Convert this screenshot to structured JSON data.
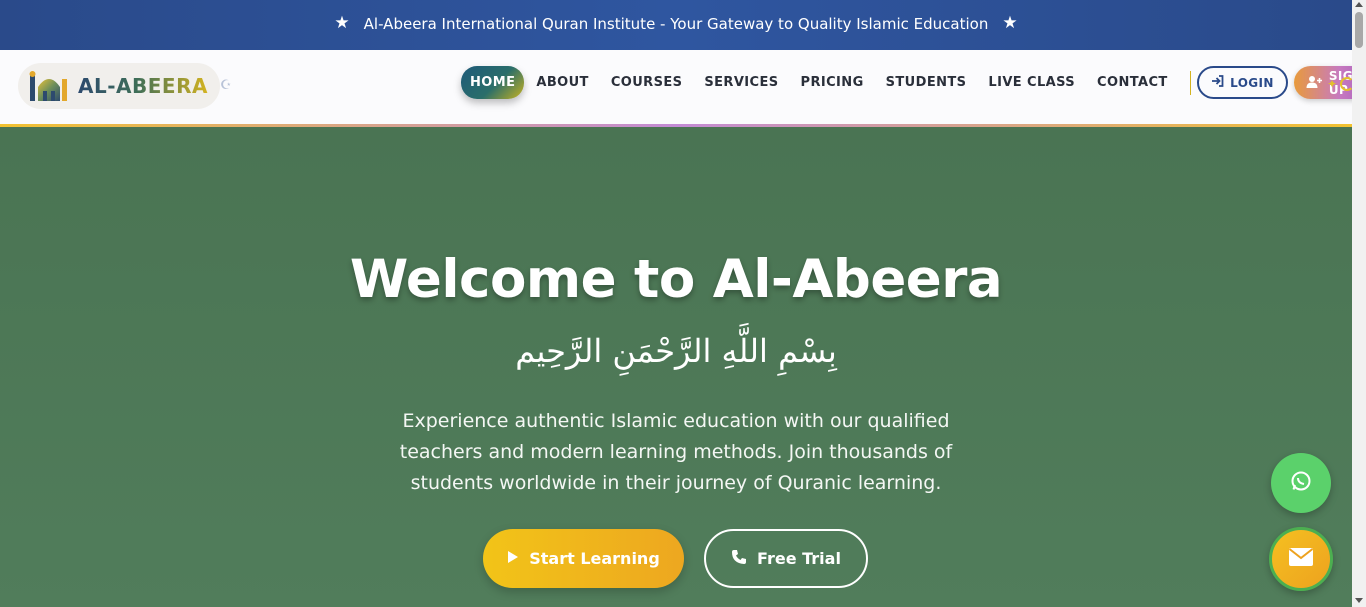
{
  "announcement": {
    "text": "Al-Abeera International Quran Institute - Your Gateway to Quality Islamic Education",
    "icon": "star-icon"
  },
  "brand": {
    "name": "AL-ABEERA",
    "logo_icon": "mosque-icon"
  },
  "nav": {
    "items": [
      {
        "label": "HOME",
        "active": true
      },
      {
        "label": "ABOUT"
      },
      {
        "label": "COURSES"
      },
      {
        "label": "SERVICES"
      },
      {
        "label": "PRICING"
      },
      {
        "label": "STUDENTS"
      },
      {
        "label": "LIVE CLASS"
      },
      {
        "label": "CONTACT"
      }
    ],
    "login_label": "LOGIN",
    "signup_label": "SIGN UP"
  },
  "hero": {
    "title": "Welcome to Al-Abeera",
    "arabic": "بِسْمِ اللَّهِ الرَّحْمَنِ الرَّحِيم",
    "description": "Experience authentic Islamic education with our qualified teachers and modern learning methods. Join thousands of students worldwide in their journey of Quranic learning.",
    "primary_cta": "Start Learning",
    "secondary_cta": "Free Trial"
  },
  "floating": {
    "whatsapp_icon": "whatsapp-icon",
    "mail_icon": "envelope-icon"
  },
  "colors": {
    "topbar": "#2f56a0",
    "hero_bg": "#4f7a57",
    "accent_gold": "#f2c418",
    "whatsapp": "#5bd16b"
  }
}
